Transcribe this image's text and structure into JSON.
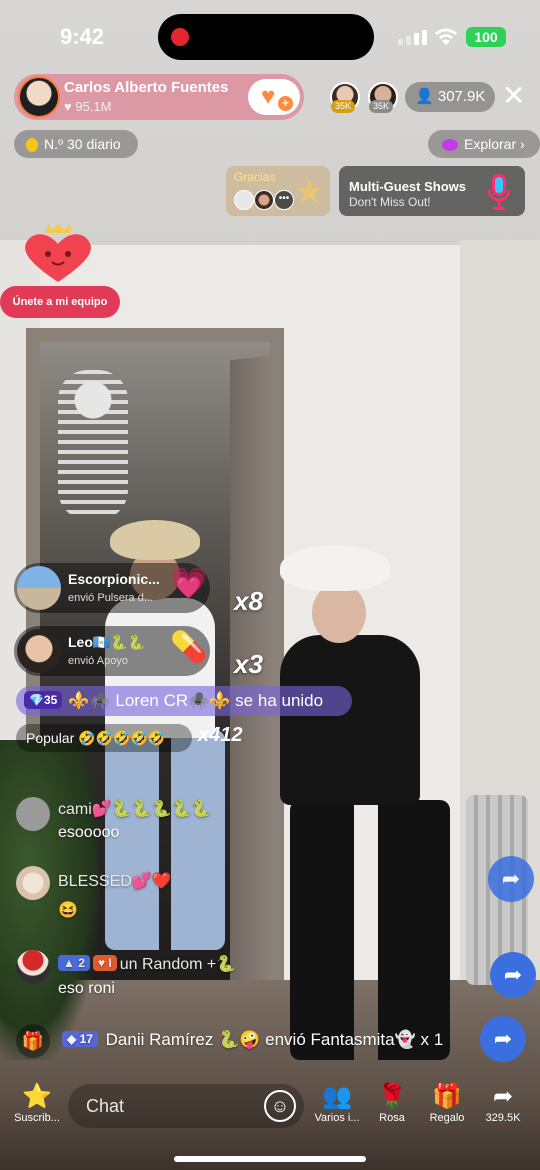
{
  "status_bar": {
    "time": "9:42",
    "battery": "100"
  },
  "host": {
    "name": "Carlos Alberto Fuentes",
    "likes": "95.1M"
  },
  "viewers": {
    "badge1": "35K",
    "badge2": "35K",
    "count": "307.9K"
  },
  "rank": {
    "label": "N.º 30 diario"
  },
  "explore": {
    "label": "Explorar"
  },
  "gracias": {
    "label": "Gracias"
  },
  "promo": {
    "title": "Multi-Guest Shows",
    "subtitle": "Don't Miss Out!"
  },
  "team": {
    "label": "Únete a mi equipo"
  },
  "gifts": [
    {
      "name": "Escorpionic...",
      "sub": "envió Pulsera d...",
      "mult": "x8"
    },
    {
      "name": "Leo🇬🇹🐍🐍",
      "sub": "envió Apoyo",
      "mult": "x3"
    }
  ],
  "join": {
    "level": "35",
    "text": "⚜️🕷️ Loren CR🕷️⚜️ se ha unido"
  },
  "popular": {
    "label": "Popular 🤣🤣🤣🤣🤣",
    "mult": "x412"
  },
  "comments": [
    {
      "name": "cami💕🐍🐍🐍🐍🐍",
      "text": "esooooo"
    },
    {
      "name": "BLESSED💕❤️",
      "text": "😆"
    },
    {
      "badge1": "2",
      "badge2": "I",
      "name": "un Random +🐍",
      "text": "eso roni"
    }
  ],
  "system": {
    "level": "17",
    "text": "Danii Ramírez 🐍🤪 envió Fantasmita👻 x 1"
  },
  "bottom": {
    "subscribe": "Suscrib...",
    "chat_placeholder": "Chat",
    "multi": "Varios i...",
    "rose": "Rosa",
    "gift": "Regalo",
    "share": "329.5K"
  }
}
